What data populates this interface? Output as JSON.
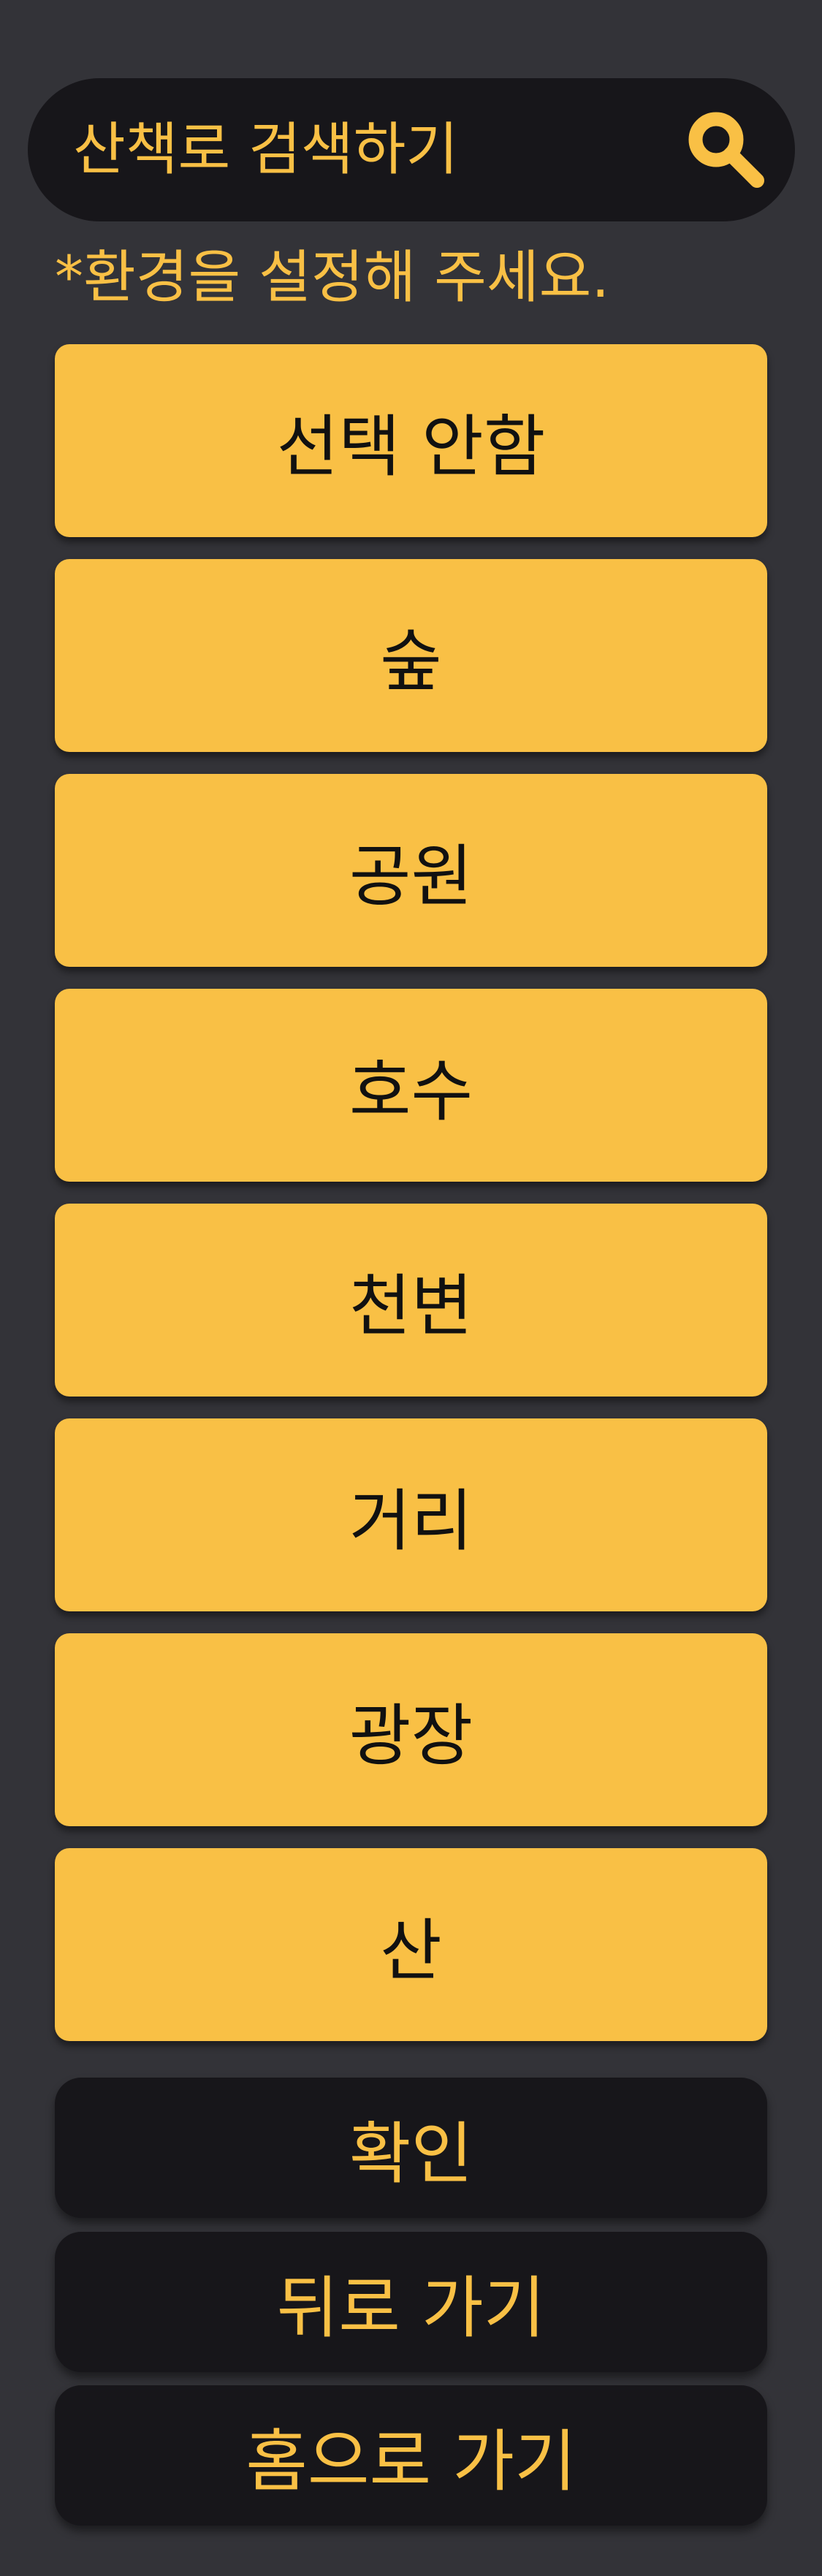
{
  "search": {
    "placeholder": "산책로 검색하기",
    "icon": "search-icon"
  },
  "hint": "*환경을 설정해 주세요.",
  "options": [
    {
      "label": "선택 안함"
    },
    {
      "label": "숲"
    },
    {
      "label": "공원"
    },
    {
      "label": "호수"
    },
    {
      "label": "천변"
    },
    {
      "label": "거리"
    },
    {
      "label": "광장"
    },
    {
      "label": "산"
    }
  ],
  "actions": {
    "confirm": "확인",
    "back": "뒤로 가기",
    "home": "홈으로 가기"
  },
  "colors": {
    "background": "#333338",
    "accent": "#f9c045",
    "dark": "#17161a"
  }
}
